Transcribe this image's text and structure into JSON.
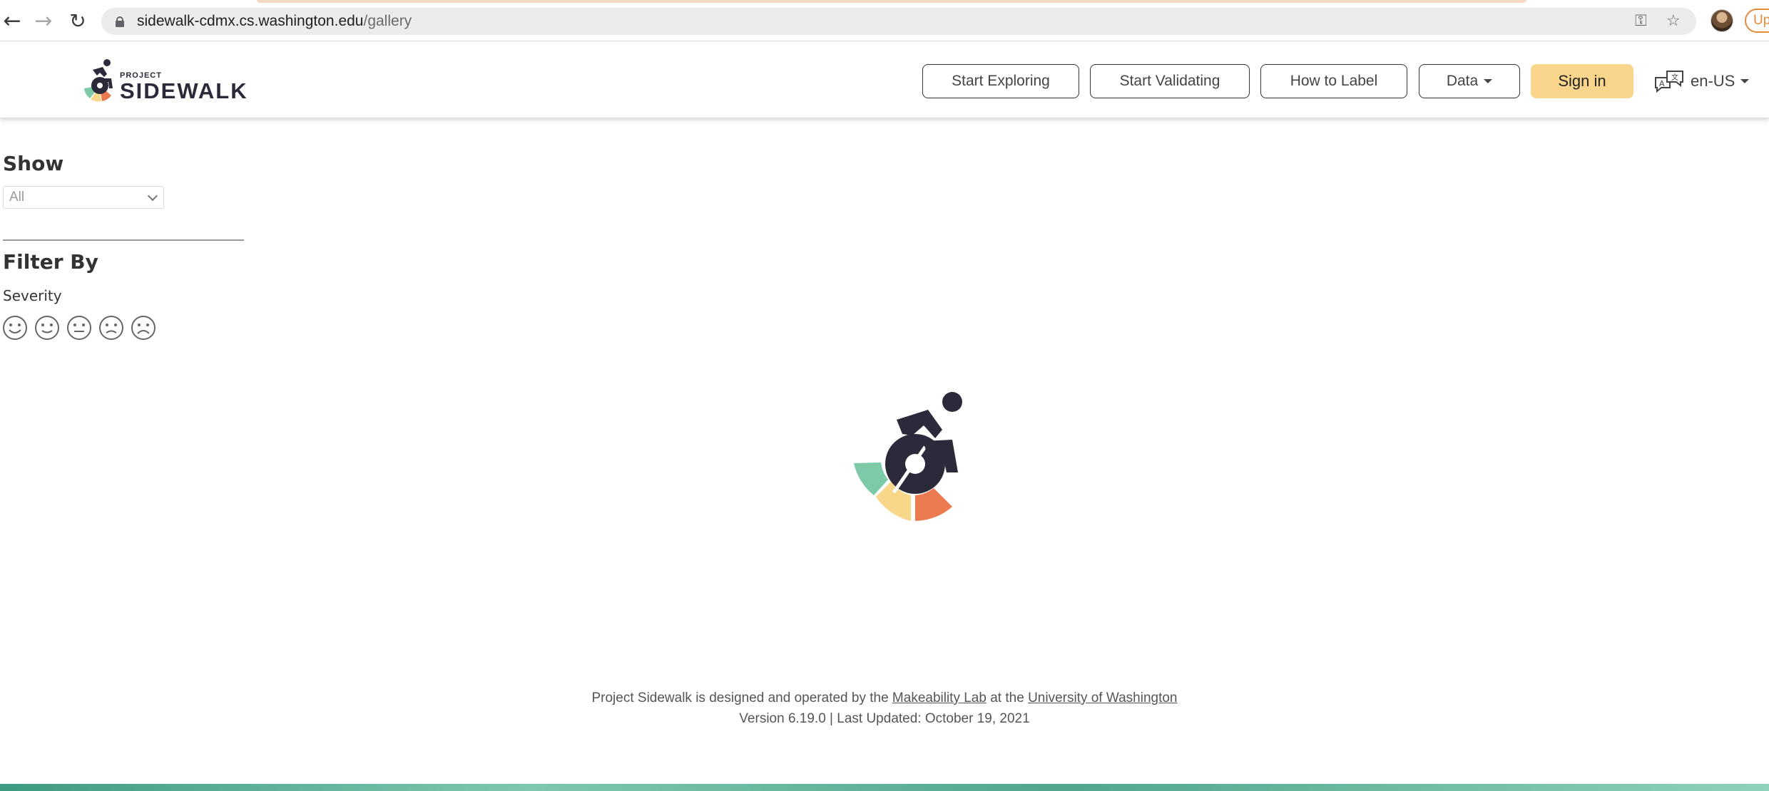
{
  "browser": {
    "url_domain": "sidewalk-cdmx.cs.washington.edu",
    "url_path": "/gallery",
    "update_label": "Up"
  },
  "header": {
    "logo_small": "PROJECT",
    "logo_big": "SIDEWALK",
    "nav": {
      "start_exploring": "Start Exploring",
      "start_validating": "Start Validating",
      "how_to_label": "How to Label",
      "data": "Data"
    },
    "sign_in": "Sign in",
    "language": "en-US"
  },
  "sidebar": {
    "show_title": "Show",
    "show_select": {
      "selected": "All"
    },
    "filter_title": "Filter By",
    "severity_label": "Severity",
    "severity_levels": [
      1,
      2,
      3,
      4,
      5
    ]
  },
  "footer": {
    "line1_prefix": "Project Sidewalk is designed and operated by the ",
    "lab_link": "Makeability Lab",
    "line1_mid": " at the ",
    "uw_link": "University of Washington",
    "line2": "Version 6.19.0 | Last Updated: October 19, 2021"
  },
  "colors": {
    "brand_dark": "#2b2a3a",
    "sign_in_bg": "#f9d68b",
    "logo_green": "#7ccaa8",
    "logo_yellow": "#f8d68a",
    "logo_orange": "#ec7a4f"
  },
  "icons": [
    "back-arrow-icon",
    "forward-arrow-icon",
    "reload-icon",
    "lock-icon",
    "key-icon",
    "star-icon",
    "translate-icon",
    "caret-down-icon",
    "smiley-face-icon",
    "frown-face-icon",
    "wheelchair-logo-icon"
  ]
}
